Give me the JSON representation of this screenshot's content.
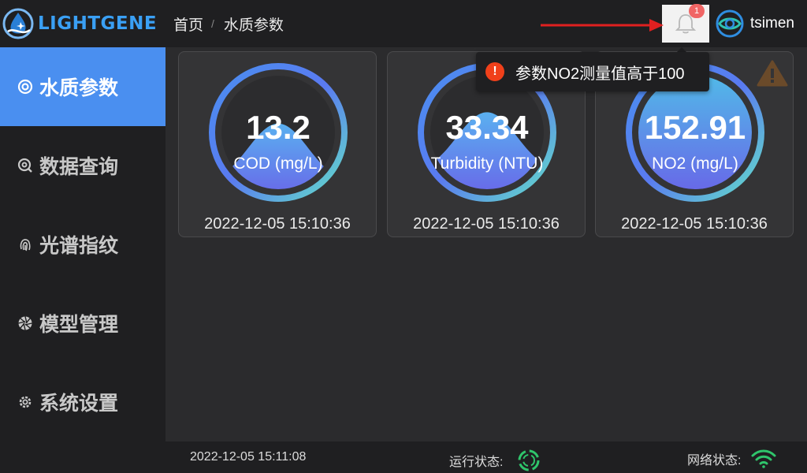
{
  "app": {
    "brand": "LIGHTGENE"
  },
  "sidebar": {
    "items": [
      {
        "label": "水质参数",
        "icon": "target-icon",
        "active": true
      },
      {
        "label": "数据查询",
        "icon": "search-icon"
      },
      {
        "label": "光谱指纹",
        "icon": "fingerprint-icon"
      },
      {
        "label": "模型管理",
        "icon": "aperture-icon"
      },
      {
        "label": "系统设置",
        "icon": "gear-icon"
      }
    ]
  },
  "header": {
    "breadcrumb": {
      "home": "首页",
      "separator": "/",
      "current": "水质参数"
    },
    "notifications": {
      "count": "1",
      "icon": "bell-icon"
    },
    "user": {
      "name": "tsimen",
      "icon": "eye-logo-icon"
    }
  },
  "alert": {
    "icon": "exclamation-icon",
    "message": "参数NO2测量值高于100",
    "color": "#f0401a"
  },
  "cards": [
    {
      "value": "13.2",
      "label": "COD (mg/L)",
      "time": "2022-12-05 15:10:36",
      "fill": 0.3,
      "warning": false
    },
    {
      "value": "33.34",
      "label": "Turbidity (NTU)",
      "time": "2022-12-05 15:10:36",
      "fill": 0.4,
      "warning": false
    },
    {
      "value": "152.91",
      "label": "NO2 (mg/L)",
      "time": "2022-12-05 15:10:36",
      "fill": 1.0,
      "warning": true
    }
  ],
  "footer": {
    "time": "2022-12-05 15:11:08",
    "run_status_label": "运行状态:",
    "network_status_label": "网络状态:"
  },
  "colors": {
    "accent": "#4a8ff0",
    "brand": "#3aa0f5",
    "status_green": "#2fc56b",
    "badge": "#f06565"
  }
}
